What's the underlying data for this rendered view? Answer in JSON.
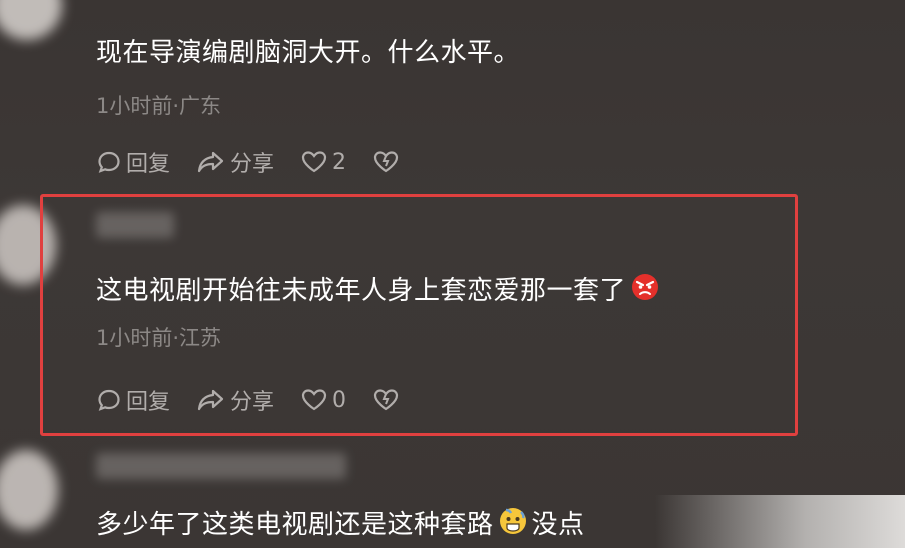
{
  "comments": [
    {
      "text": "现在导演编剧脑洞大开。什么水平。",
      "meta": "1小时前·广东",
      "reply_label": "回复",
      "share_label": "分享",
      "like_count": "2"
    },
    {
      "text": "这电视剧开始往未成年人身上套恋爱那一套了",
      "meta": "1小时前·江苏",
      "reply_label": "回复",
      "share_label": "分享",
      "like_count": "0",
      "emoji": "angry-face-icon",
      "highlight_color": "#e0403f"
    },
    {
      "text": "多少年了这类电视剧还是这种套路",
      "trailing_text": "没点",
      "emoji": "anxious-sweat-face-icon"
    }
  ]
}
